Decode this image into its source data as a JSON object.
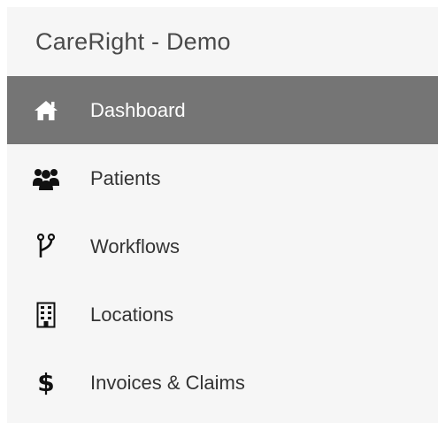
{
  "app": {
    "title": "CareRight - Demo"
  },
  "sidebar": {
    "items": [
      {
        "label": "Dashboard",
        "icon": "home-icon",
        "active": true
      },
      {
        "label": "Patients",
        "icon": "users-icon",
        "active": false
      },
      {
        "label": "Workflows",
        "icon": "workflow-branch-icon",
        "active": false
      },
      {
        "label": "Locations",
        "icon": "building-icon",
        "active": false
      },
      {
        "label": "Invoices & Claims",
        "icon": "dollar-icon",
        "icon_glyph": "$",
        "active": false
      }
    ]
  },
  "colors": {
    "active_background": "#757575",
    "sidebar_background": "#f6f6f6",
    "text": "#333333",
    "active_text": "#ffffff"
  }
}
